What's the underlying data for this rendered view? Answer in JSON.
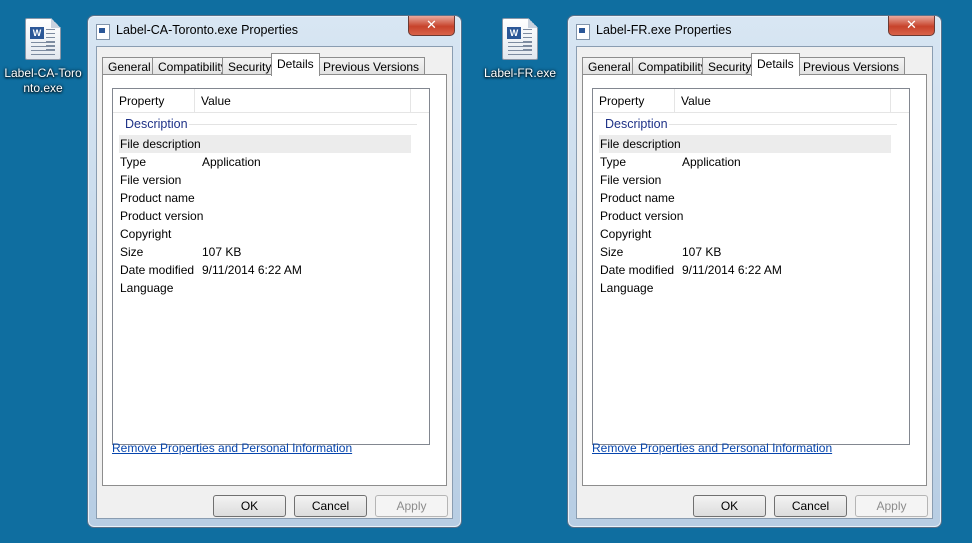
{
  "desktop_icons": [
    {
      "label": "Label-CA-Toronto.exe"
    },
    {
      "label": "Label-FR.exe"
    }
  ],
  "windows": [
    {
      "title": "Label-CA-Toronto.exe Properties",
      "close_glyph": "✕",
      "tabs": [
        "General",
        "Compatibility",
        "Security",
        "Details",
        "Previous Versions"
      ],
      "active_tab": "Details",
      "columns": [
        "Property",
        "Value"
      ],
      "group": "Description",
      "rows": [
        {
          "key": "File description",
          "value": ""
        },
        {
          "key": "Type",
          "value": "Application"
        },
        {
          "key": "File version",
          "value": ""
        },
        {
          "key": "Product name",
          "value": ""
        },
        {
          "key": "Product version",
          "value": ""
        },
        {
          "key": "Copyright",
          "value": ""
        },
        {
          "key": "Size",
          "value": "107 KB"
        },
        {
          "key": "Date modified",
          "value": "9/11/2014 6:22 AM"
        },
        {
          "key": "Language",
          "value": ""
        }
      ],
      "link": "Remove Properties and Personal Information",
      "buttons": {
        "ok": "OK",
        "cancel": "Cancel",
        "apply": "Apply"
      }
    },
    {
      "title": "Label-FR.exe Properties",
      "close_glyph": "✕",
      "tabs": [
        "General",
        "Compatibility",
        "Security",
        "Details",
        "Previous Versions"
      ],
      "active_tab": "Details",
      "columns": [
        "Property",
        "Value"
      ],
      "group": "Description",
      "rows": [
        {
          "key": "File description",
          "value": ""
        },
        {
          "key": "Type",
          "value": "Application"
        },
        {
          "key": "File version",
          "value": ""
        },
        {
          "key": "Product name",
          "value": ""
        },
        {
          "key": "Product version",
          "value": ""
        },
        {
          "key": "Copyright",
          "value": ""
        },
        {
          "key": "Size",
          "value": "107 KB"
        },
        {
          "key": "Date modified",
          "value": "9/11/2014 6:22 AM"
        },
        {
          "key": "Language",
          "value": ""
        }
      ],
      "link": "Remove Properties and Personal Information",
      "buttons": {
        "ok": "OK",
        "cancel": "Cancel",
        "apply": "Apply"
      }
    }
  ]
}
